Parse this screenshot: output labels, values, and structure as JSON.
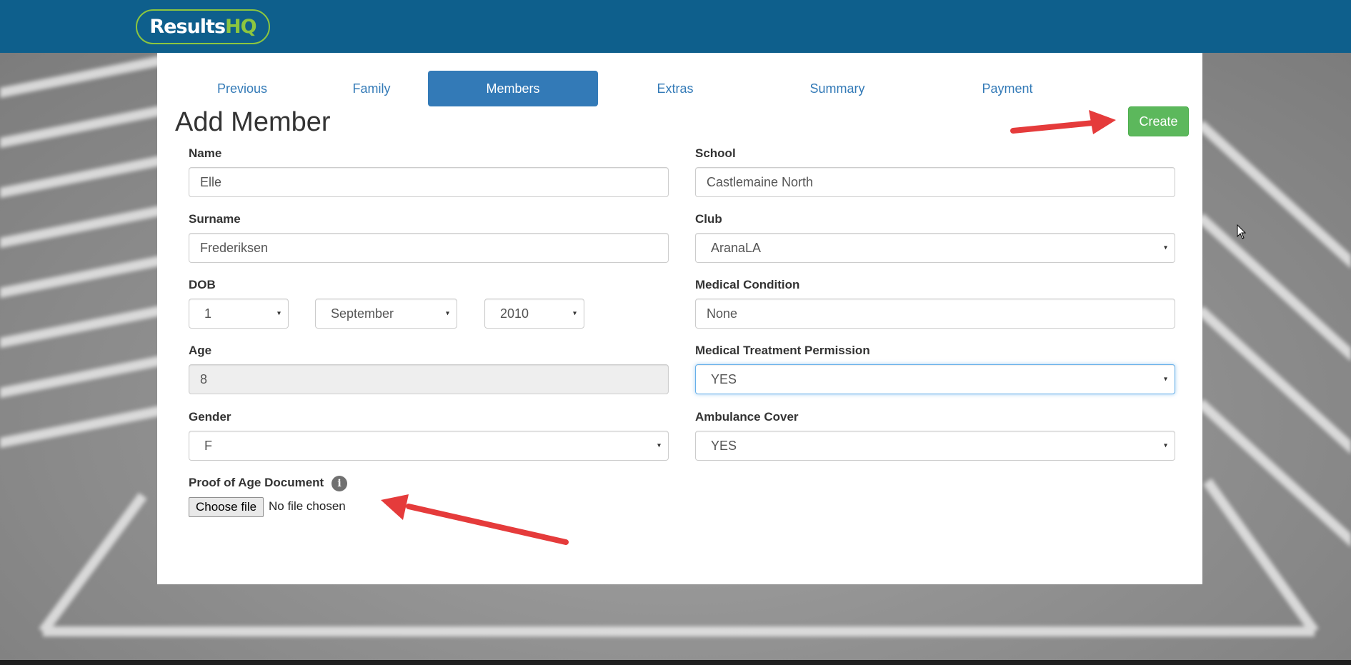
{
  "brand": {
    "logo_part1": "Results",
    "logo_part2": "HQ"
  },
  "tabs": [
    {
      "label": "Previous",
      "active": false
    },
    {
      "label": "Family",
      "active": false
    },
    {
      "label": "Members",
      "active": true
    },
    {
      "label": "Extras",
      "active": false
    },
    {
      "label": "Summary",
      "active": false
    },
    {
      "label": "Payment",
      "active": false
    }
  ],
  "page": {
    "title": "Add Member",
    "create_label": "Create"
  },
  "form": {
    "name": {
      "label": "Name",
      "value": "Elle"
    },
    "surname": {
      "label": "Surname",
      "value": "Frederiksen"
    },
    "dob": {
      "label": "DOB",
      "day": "1",
      "month": "September",
      "year": "2010"
    },
    "age": {
      "label": "Age",
      "value": "8"
    },
    "gender": {
      "label": "Gender",
      "value": "F"
    },
    "proof": {
      "label": "Proof of Age Document",
      "info_icon": "i",
      "button_label": "Choose file",
      "status": "No file chosen"
    },
    "school": {
      "label": "School",
      "value": "Castlemaine North"
    },
    "club": {
      "label": "Club",
      "value": "AranaLA"
    },
    "medical_condition": {
      "label": "Medical Condition",
      "value": "None"
    },
    "medical_treatment": {
      "label": "Medical Treatment Permission",
      "value": "YES"
    },
    "ambulance": {
      "label": "Ambulance Cover",
      "value": "YES"
    }
  },
  "icons": {
    "caret": "▾"
  },
  "colors": {
    "header": "#0e5f8c",
    "logo_accent": "#8cc63f",
    "tab_active": "#337ab7",
    "create_button": "#5cb85c",
    "annotation_arrow": "#e53b3b"
  }
}
